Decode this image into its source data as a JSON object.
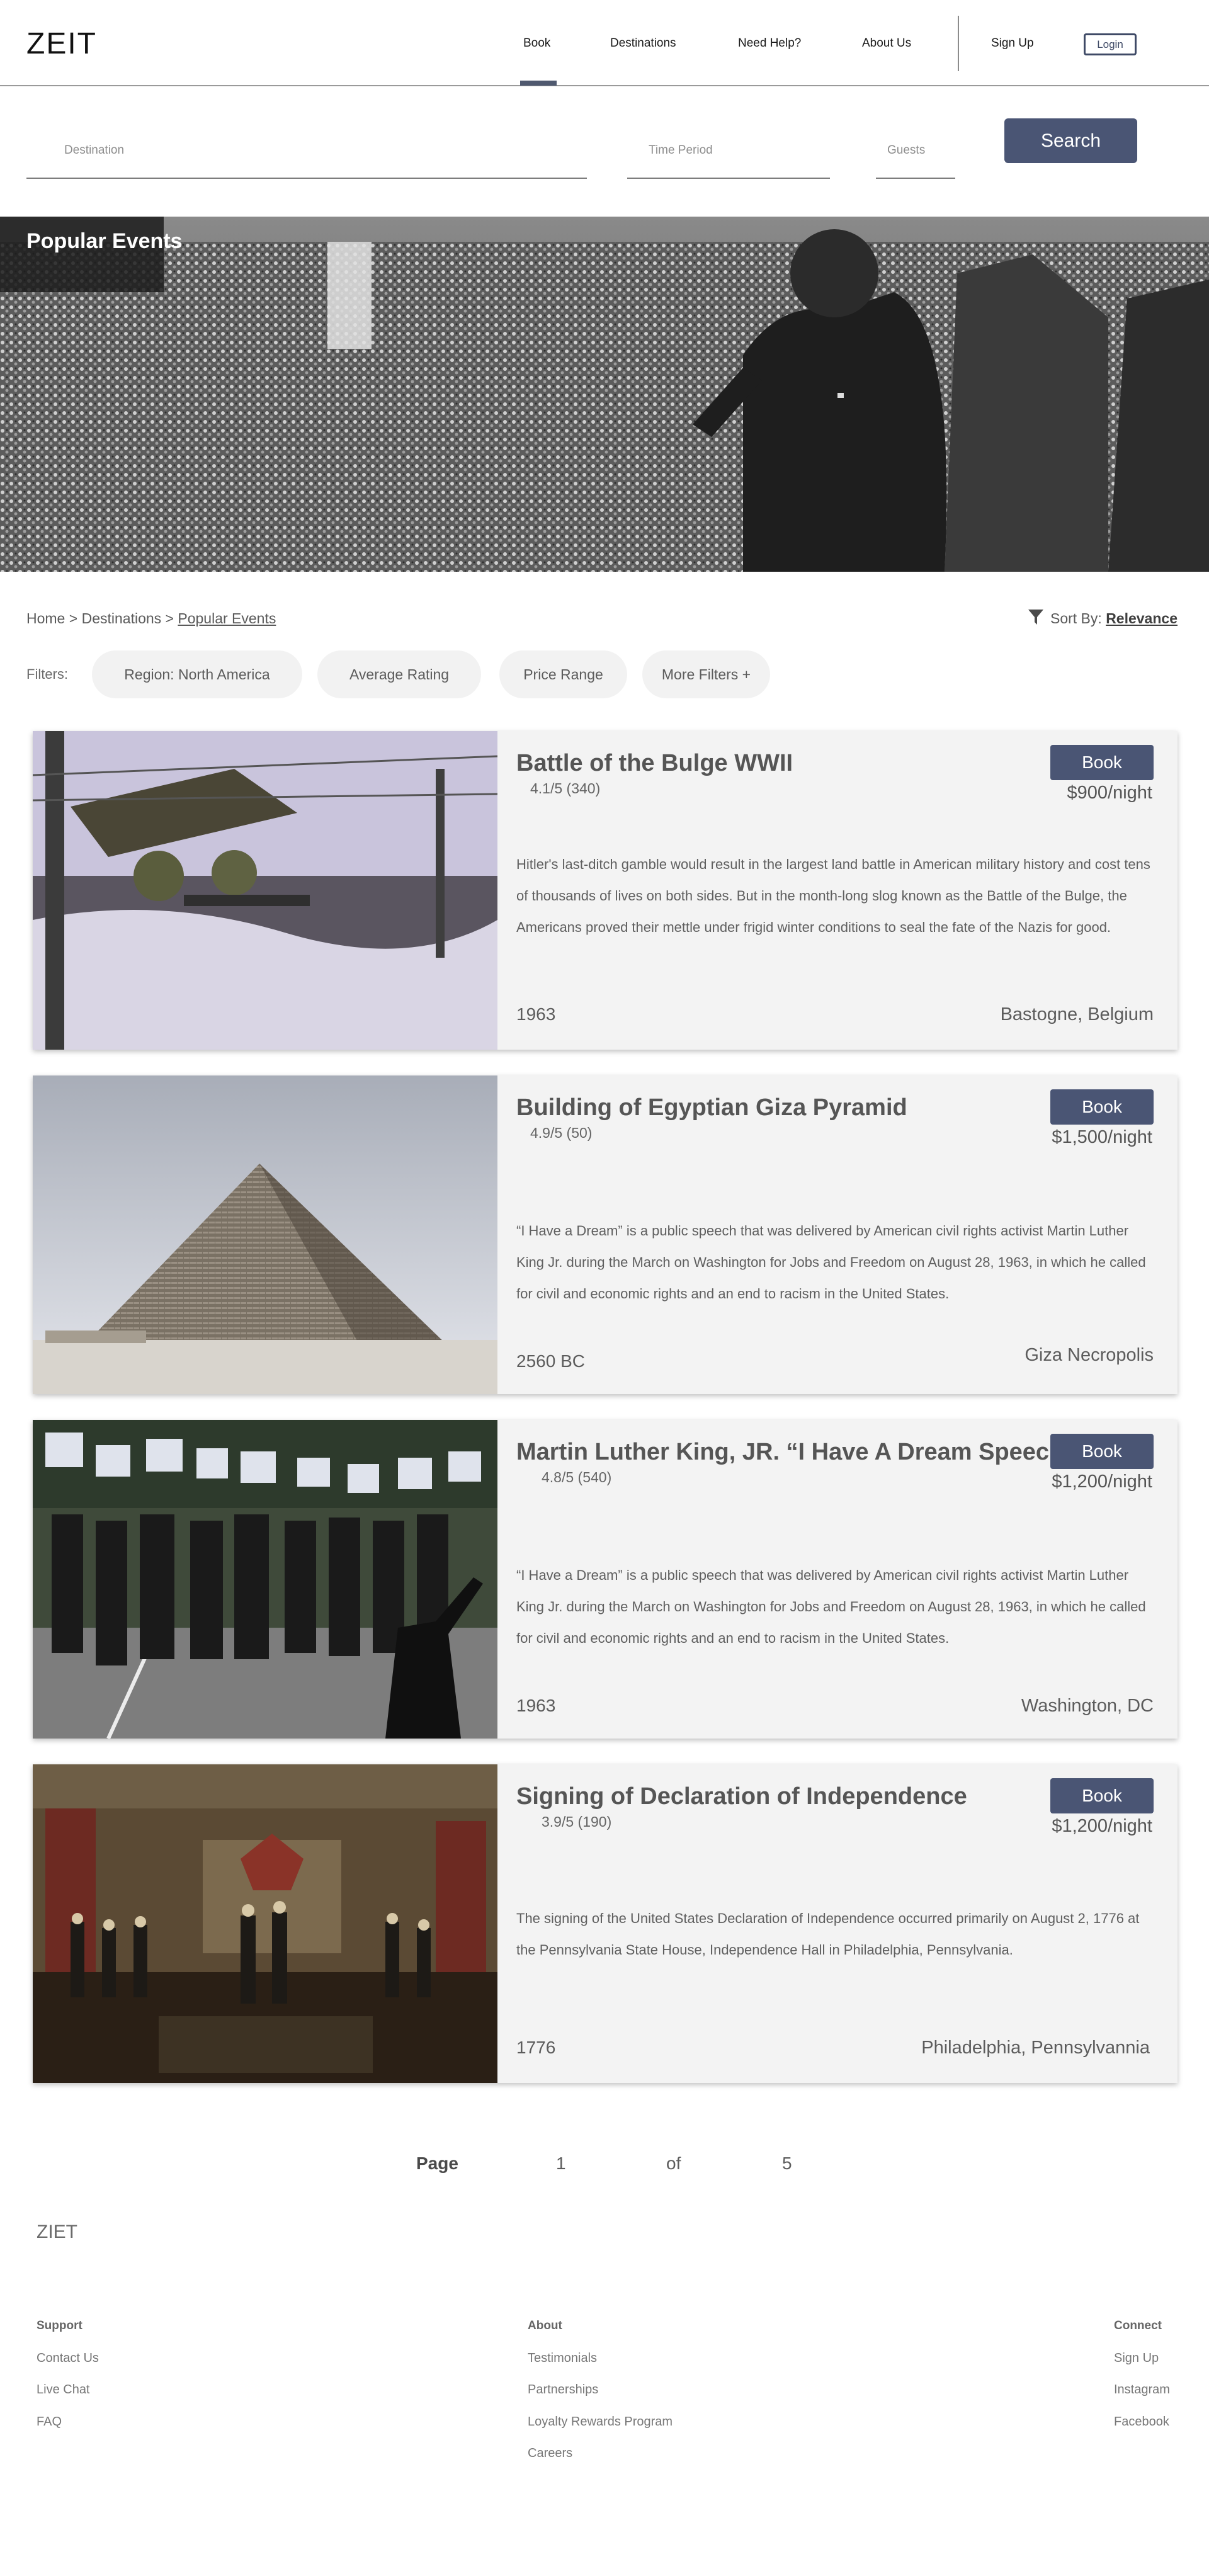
{
  "brand": "ZEIT",
  "nav": {
    "links": [
      "Book",
      "Destinations",
      "Need Help?",
      "About Us"
    ],
    "signup": "Sign Up",
    "login": "Login"
  },
  "search": {
    "destination_placeholder": "Destination",
    "time_placeholder": "Time Period",
    "guests_placeholder": "Guests",
    "button": "Search"
  },
  "hero": {
    "title": "Popular Events"
  },
  "breadcrumb": {
    "home": "Home",
    "sep": ">",
    "destinations": "Destinations",
    "current": "Popular Events"
  },
  "sort": {
    "label": "Sort By:",
    "value": "Relevance"
  },
  "filters": {
    "label": "Filters:",
    "chips": [
      "Region: North America",
      "Average Rating",
      "Price Range",
      "More Filters +"
    ]
  },
  "events": [
    {
      "title": "Battle of the Bulge WWII",
      "rating": "4.1/5 (340)",
      "book": "Book",
      "price": "$900/night",
      "description": "Hitler's last-ditch gamble would result in the largest land battle in American military history and cost tens of thousands of lives on both sides. But in the month-long slog known as the Battle of the Bulge, the Americans proved their mettle under frigid winter conditions to seal the fate of the Nazis for good.",
      "year": "1963",
      "location": "Bastogne, Belgium"
    },
    {
      "title": "Building of Egyptian Giza Pyramid",
      "rating": "4.9/5 (50)",
      "book": "Book",
      "price": "$1,500/night",
      "description": "“I Have a Dream” is a public speech that was delivered by American civil rights activist Martin Luther King Jr. during the March on Washington for Jobs and Freedom on August 28, 1963, in which he called for civil and economic rights and an end to racism in the United States.",
      "year": "2560 BC",
      "location": "Giza Necropolis"
    },
    {
      "title": "Martin Luther King, JR. “I Have A Dream Speech”",
      "rating": "4.8/5 (540)",
      "book": "Book",
      "price": "$1,200/night",
      "description": "“I Have a Dream” is a public speech that was delivered by American civil rights activist Martin Luther King Jr. during the March on Washington for Jobs and Freedom on August 28, 1963, in which he called for civil and economic rights and an end to racism in the United States.",
      "year": "1963",
      "location": "Washington, DC"
    },
    {
      "title": "Signing of Declaration of Independence",
      "rating": "3.9/5 (190)",
      "book": "Book",
      "price": "$1,200/night",
      "description": "The signing of the United States Declaration of Independence occurred primarily on August 2, 1776 at the Pennsylvania State House, Independence Hall in Philadelphia, Pennsylvania.",
      "year": "1776",
      "location": "Philadelphia, Pennsylvannia"
    }
  ],
  "pagination": {
    "label": "Page",
    "current": "1",
    "of": "of",
    "total": "5"
  },
  "footer": {
    "logo": "ZIET",
    "support": {
      "heading": "Support",
      "links": [
        "Contact Us",
        "Live Chat",
        "FAQ"
      ]
    },
    "about": {
      "heading": "About",
      "links": [
        "Testimonials",
        "Partnerships",
        "Loyalty Rewards Program",
        "Careers"
      ]
    },
    "connect": {
      "heading": "Connect",
      "links": [
        "Sign Up",
        "Instagram",
        "Facebook"
      ]
    }
  },
  "colors": {
    "accent": "#4a5574",
    "card_bg": "#f3f3f3",
    "chip_bg": "#f2f2f2"
  }
}
